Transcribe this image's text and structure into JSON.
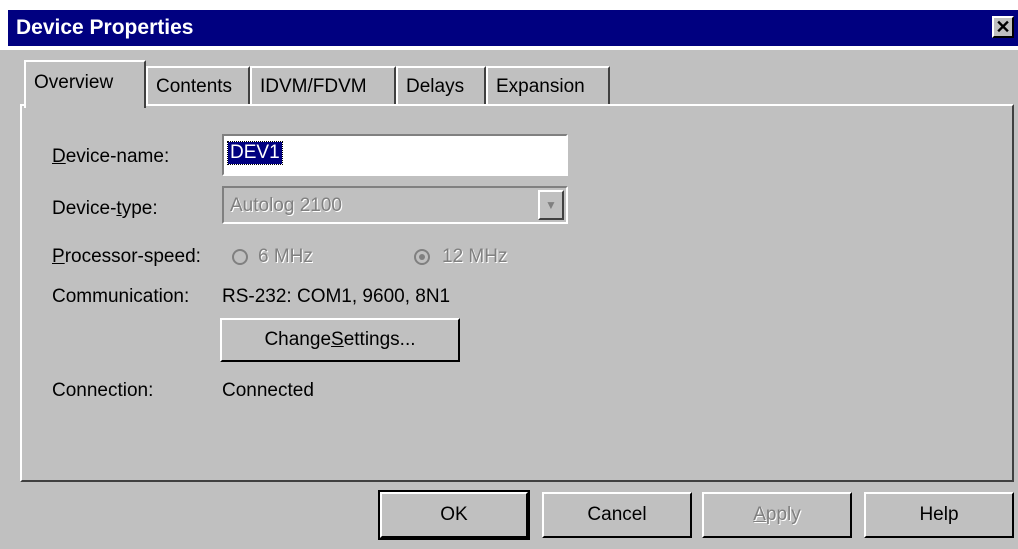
{
  "window": {
    "title": "Device Properties",
    "close_symbol": "✕"
  },
  "tabs": [
    {
      "label": "Overview",
      "active": true
    },
    {
      "label": "Contents",
      "active": false
    },
    {
      "label": "IDVM/FDVM",
      "active": false
    },
    {
      "label": "Delays",
      "active": false
    },
    {
      "label": "Expansion",
      "active": false
    }
  ],
  "overview": {
    "device_name": {
      "label_pre": "",
      "label_key": "D",
      "label_post": "evice-name:",
      "value": "DEV1"
    },
    "device_type": {
      "label_pre": "Device-",
      "label_key": "t",
      "label_post": "ype:",
      "value": "Autolog 2100"
    },
    "processor_speed": {
      "label_pre": "",
      "label_key": "P",
      "label_post": "rocessor-speed:",
      "options": [
        "6 MHz",
        "12 MHz"
      ],
      "selected": "12 MHz"
    },
    "communication": {
      "label": "Communication:",
      "value": "RS-232: COM1, 9600, 8N1"
    },
    "change_settings": {
      "pre": "Change ",
      "key": "S",
      "post": "ettings..."
    },
    "connection": {
      "label": "Connection:",
      "value": "Connected"
    }
  },
  "footer": {
    "ok": "OK",
    "cancel": "Cancel",
    "apply_key": "A",
    "apply_rest": "pply",
    "help": "Help"
  },
  "colors": {
    "titlebar": "#000080",
    "face": "#c0c0c0",
    "disabled_text": "#808080"
  }
}
